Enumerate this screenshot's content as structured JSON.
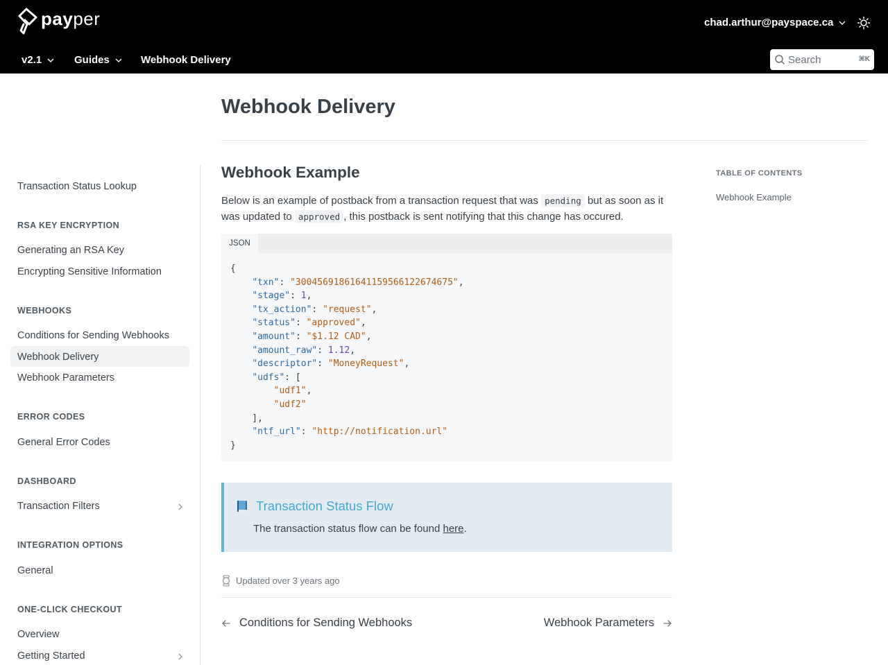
{
  "header": {
    "brand_bold": "pay",
    "brand_light": "per",
    "user_email": "chad.arthur@payspace.ca",
    "nav": {
      "version": "v2.1",
      "guides": "Guides",
      "current": "Webhook Delivery"
    },
    "search": {
      "placeholder": "Search",
      "shortcut": "⌘K"
    }
  },
  "sidebar": {
    "items": [
      {
        "type": "link",
        "label": "Transaction Status Lookup"
      },
      {
        "type": "heading",
        "label": "RSA KEY ENCRYPTION"
      },
      {
        "type": "link",
        "label": "Generating an RSA Key"
      },
      {
        "type": "link",
        "label": "Encrypting Sensitive Information"
      },
      {
        "type": "heading",
        "label": "WEBHOOKS"
      },
      {
        "type": "link",
        "label": "Conditions for Sending Webhooks"
      },
      {
        "type": "link",
        "label": "Webhook Delivery",
        "active": true
      },
      {
        "type": "link",
        "label": "Webhook Parameters"
      },
      {
        "type": "heading",
        "label": "ERROR CODES"
      },
      {
        "type": "link",
        "label": "General Error Codes"
      },
      {
        "type": "heading",
        "label": "DASHBOARD"
      },
      {
        "type": "link",
        "label": "Transaction Filters",
        "expandable": true
      },
      {
        "type": "heading",
        "label": "INTEGRATION OPTIONS"
      },
      {
        "type": "link",
        "label": "General"
      },
      {
        "type": "heading",
        "label": "ONE-CLICK CHECKOUT"
      },
      {
        "type": "link",
        "label": "Overview"
      },
      {
        "type": "link",
        "label": "Getting Started",
        "expandable": true
      }
    ]
  },
  "main": {
    "title": "Webhook Delivery",
    "section_title": "Webhook Example",
    "paragraph": {
      "part1": "Below is an example of postback from a transaction request that was ",
      "code1": "pending",
      "part2": " but as soon as it was updated to ",
      "code2": "approved",
      "part3": ", this postback is sent notifying that this change has occured."
    },
    "code_tab": "JSON",
    "code": {
      "txn_key": "\"txn\"",
      "txn_val": "\"300456918616411595661226746 75\"",
      "stage_key": "\"stage\"",
      "stage_val": "1",
      "tx_action_key": "\"tx_action\"",
      "tx_action_val": "\"request\"",
      "status_key": "\"status\"",
      "status_val": "\"approved\"",
      "amount_key": "\"amount\"",
      "amount_val": "\"$1.12 CAD\"",
      "amount_raw_key": "\"amount_raw\"",
      "amount_raw_val": "1.12",
      "descriptor_key": "\"descriptor\"",
      "descriptor_val": "\"MoneyRequest\"",
      "udfs_key": "\"udfs\"",
      "udf1": "\"udf1\"",
      "udf2": "\"udf2\"",
      "ntf_url_key": "\"ntf_url\"",
      "ntf_url_val": "\"http://notification.url\""
    },
    "callout": {
      "title": "Transaction Status Flow",
      "body_prefix": "The transaction status flow can be found ",
      "link": "here",
      "body_suffix": "."
    },
    "updated": "Updated over 3 years ago",
    "prev_label": "Conditions for Sending Webhooks",
    "next_label": "Webhook Parameters"
  },
  "toc": {
    "heading": "TABLE OF CONTENTS",
    "items": [
      "Webhook Example"
    ]
  }
}
